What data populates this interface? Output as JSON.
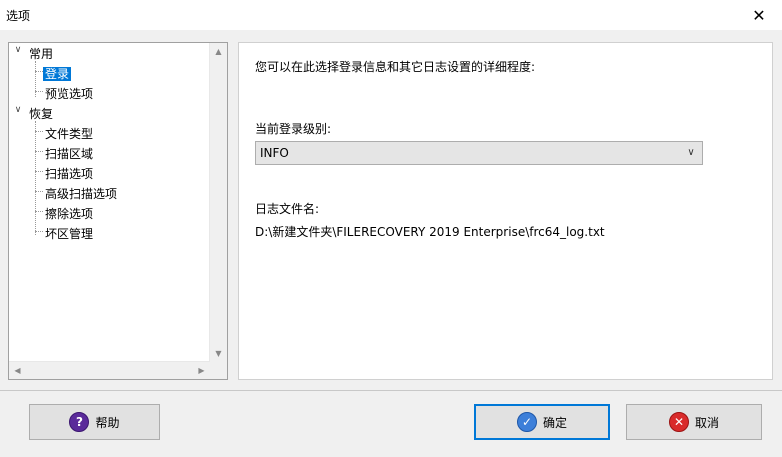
{
  "window": {
    "title": "选项",
    "close_glyph": "✕"
  },
  "tree": {
    "items": [
      {
        "label": "常用",
        "expander": "∨"
      },
      {
        "label": "登录"
      },
      {
        "label": "预览选项"
      },
      {
        "label": "恢复",
        "expander": "∨"
      },
      {
        "label": "文件类型"
      },
      {
        "label": "扫描区域"
      },
      {
        "label": "扫描选项"
      },
      {
        "label": "高级扫描选项"
      },
      {
        "label": "擦除选项"
      },
      {
        "label": "坏区管理"
      }
    ],
    "scroll_up": "▲",
    "scroll_down": "▼",
    "scroll_left": "◀",
    "scroll_right": "▶"
  },
  "panel": {
    "description": "您可以在此选择登录信息和其它日志设置的详细程度:",
    "level_label": "当前登录级别:",
    "level_value": "INFO",
    "level_arrow": "∨",
    "log_file_label": "日志文件名:",
    "log_file_path": "D:\\新建文件夹\\FILERECOVERY 2019 Enterprise\\frc64_log.txt"
  },
  "buttons": {
    "help_label": "帮助",
    "help_glyph": "?",
    "ok_label": "确定",
    "ok_glyph": "✓",
    "cancel_label": "取消",
    "cancel_glyph": "✕"
  },
  "colors": {
    "selection": "#0078d7",
    "help_icon": "#5a2a9a",
    "ok_icon": "#3d7fd9",
    "cancel_icon": "#d92b2b"
  }
}
